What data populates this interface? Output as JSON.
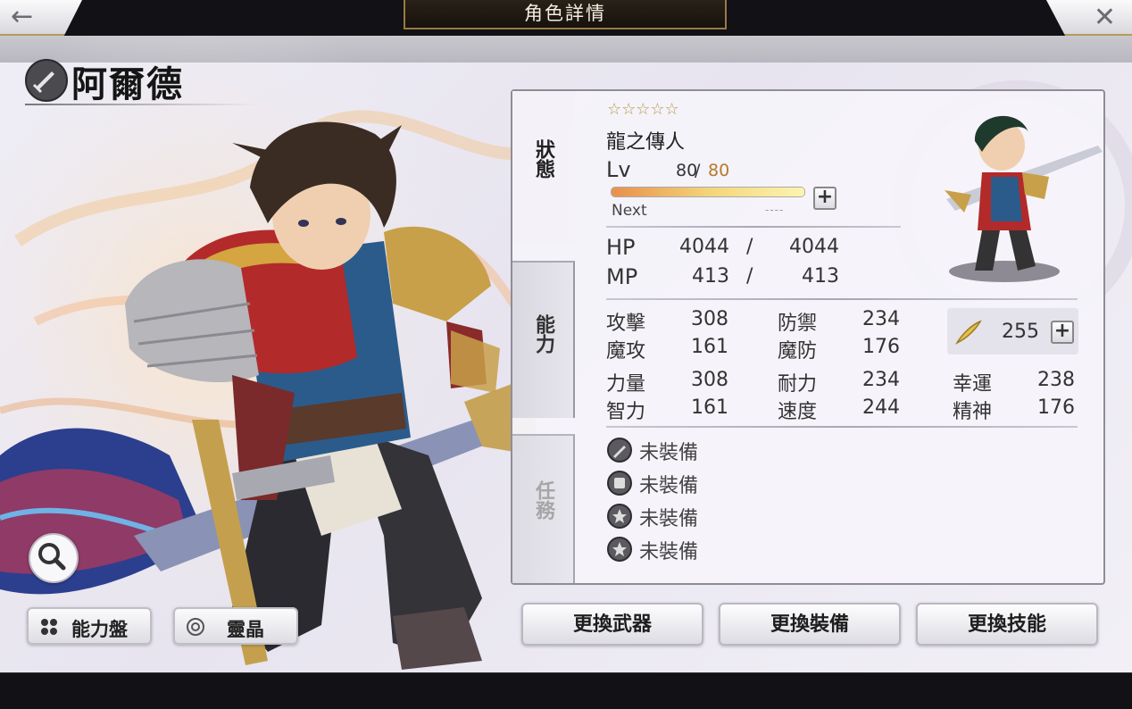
{
  "header": {
    "title": "角色詳情",
    "back_icon": "←",
    "close_icon": "✕"
  },
  "character": {
    "name": "阿爾德",
    "class_icon": "sword-class-icon",
    "rarity_stars": "☆☆☆☆☆",
    "title": "龍之傳人",
    "level_label": "Lv",
    "level": "80",
    "level_sep": "/",
    "level_max": "80",
    "exp_fraction": 1.0,
    "next_label": "Next",
    "next_value": "----"
  },
  "tabs": [
    {
      "label": "狀態",
      "active": true
    },
    {
      "label": "能力",
      "active": false
    },
    {
      "label": "任務",
      "active": false
    }
  ],
  "vitals": {
    "hp_label": "HP",
    "hp_current": "4044",
    "hp_sep": "/",
    "hp_max": "4044",
    "mp_label": "MP",
    "mp_current": "413",
    "mp_sep": "/",
    "mp_max": "413"
  },
  "stats": {
    "atk_label": "攻擊",
    "atk": "308",
    "def_label": "防禦",
    "def": "234",
    "matk_label": "魔攻",
    "matk": "161",
    "mdef_label": "魔防",
    "mdef": "176",
    "str_label": "力量",
    "str": "308",
    "vit_label": "耐力",
    "vit": "234",
    "luck_label": "幸運",
    "luck": "238",
    "int_label": "智力",
    "int": "161",
    "spd_label": "速度",
    "spd": "244",
    "spirit_label": "精神",
    "spirit": "176",
    "feather_value": "255"
  },
  "equipment": [
    {
      "icon": "weapon-slot-icon",
      "label": "未裝備"
    },
    {
      "icon": "armor-slot-icon",
      "label": "未裝備"
    },
    {
      "icon": "accessory-slot-icon",
      "label": "未裝備"
    },
    {
      "icon": "accessory-slot-icon",
      "label": "未裝備"
    }
  ],
  "side_buttons": {
    "ability_board": "能力盤",
    "spirit_crystal": "靈晶"
  },
  "actions": {
    "change_weapon": "更換武器",
    "change_equipment": "更換裝備",
    "change_skill": "更換技能"
  },
  "colors": {
    "accent_gold": "#b59a4a",
    "exp_orange": "#e98f4a",
    "level_max": "#b57a2a"
  }
}
